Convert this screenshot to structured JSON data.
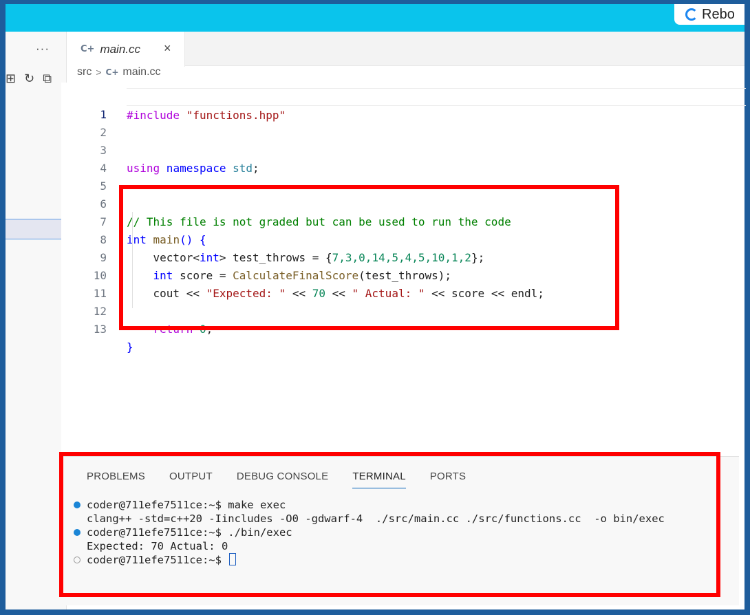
{
  "topbar": {
    "pill_text": "Rebo"
  },
  "sidebar": {
    "more_label": "···",
    "actions": [
      "⊞",
      "↻",
      "⧉"
    ]
  },
  "editor_tab": {
    "icon_text": "C+",
    "label": "main.cc",
    "close": "×"
  },
  "breadcrumb": {
    "folder": "src",
    "separator": ">",
    "icon_text": "C+",
    "file": "main.cc"
  },
  "editor": {
    "lines": [
      {
        "n": "1"
      },
      {
        "n": "2"
      },
      {
        "n": "3"
      },
      {
        "n": "4"
      },
      {
        "n": "5"
      },
      {
        "n": "6"
      },
      {
        "n": "7"
      },
      {
        "n": "8"
      },
      {
        "n": "9"
      },
      {
        "n": "10"
      },
      {
        "n": "11"
      },
      {
        "n": "12"
      },
      {
        "n": "13"
      }
    ],
    "tokens": {
      "l1_pp": "#include",
      "l1_str": " \"functions.hpp\"",
      "l3_using": "using",
      "l3_ns": " namespace",
      "l3_std": " std",
      "l3_semi": ";",
      "l6_cmt": "// This file is not graded but can be used to run the code",
      "l7_int": "int",
      "l7_main": " main",
      "l7_rest": "() {",
      "l8_a": "    vector<",
      "l8_int": "int",
      "l8_b": "> test_throws = {",
      "l8_nums": "7,3,0,14,5,4,5,10,1,2",
      "l8_c": "};",
      "l9_int": "    int",
      "l9_a": " score = ",
      "l9_fn": "CalculateFinalScore",
      "l9_b": "(test_throws);",
      "l10_a": "    cout << ",
      "l10_s1": "\"Expected: \"",
      "l10_b": " << ",
      "l10_n": "70",
      "l10_c": " << ",
      "l10_s2": "\" Actual: \"",
      "l10_d": " << score << endl;",
      "l12_ret": "    return",
      "l12_num": " 0",
      "l12_semi": ";",
      "l13": "}"
    }
  },
  "panel": {
    "tabs": [
      "PROBLEMS",
      "OUTPUT",
      "DEBUG CONSOLE",
      "TERMINAL",
      "PORTS"
    ],
    "active_tab": "TERMINAL",
    "terminal": [
      "coder@711efe7511ce:~$ make exec",
      "clang++ -std=c++20 -Iincludes -O0 -gdwarf-4  ./src/main.cc ./src/functions.cc  -o bin/exec",
      "coder@711efe7511ce:~$ ./bin/exec",
      "Expected: 70 Actual: 0",
      "coder@711efe7511ce:~$ "
    ]
  },
  "colors": {
    "highlight": "#ff0000",
    "topbar": "#0ac4ec",
    "frame": "#1e5d9c"
  }
}
